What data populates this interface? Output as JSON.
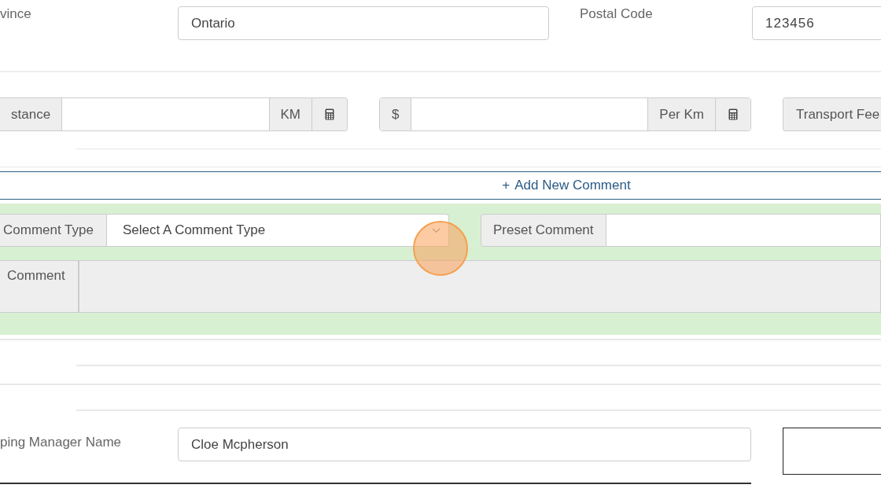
{
  "address_row": [
    {
      "label": "vince",
      "value": "Ontario"
    },
    {
      "label": "Postal Code",
      "value": "123456"
    }
  ],
  "rate_row": {
    "distance": {
      "label": "stance",
      "unit": "KM"
    },
    "rate": {
      "prefix": "$",
      "unit": "Per Km"
    },
    "transport_fee": {
      "label": "Transport Fee"
    }
  },
  "add_comment": {
    "icon": "+",
    "label": "Add New Comment"
  },
  "comment_form": {
    "comment_type": {
      "label": "Comment Type",
      "placeholder": "Select A Comment Type"
    },
    "preset": {
      "label": "Preset Comment"
    },
    "comment": {
      "label": "Comment",
      "disabled": true
    }
  },
  "manager": {
    "label": "ping Manager Name",
    "value": "Cloe Mcpherson"
  }
}
